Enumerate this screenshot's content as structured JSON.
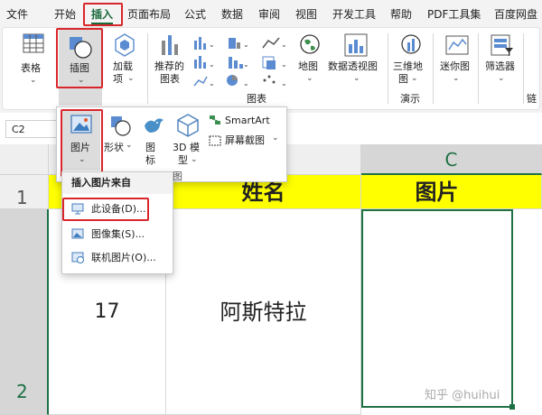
{
  "tabs": [
    "文件",
    "开始",
    "插入",
    "页面布局",
    "公式",
    "数据",
    "审阅",
    "视图",
    "开发工具",
    "帮助",
    "PDF工具集",
    "百度网盘"
  ],
  "active_tab": "插入",
  "ribbon": {
    "table": "表格",
    "illustrations": "插图",
    "addins_line1": "加载",
    "addins_line2": "项",
    "recommended_line1": "推荐的",
    "recommended_line2": "图表",
    "charts_group": "图表",
    "map": "地图",
    "pivot_chart": "数据透视图",
    "map3d_line1": "三维地",
    "map3d_line2": "图",
    "demo_group": "演示",
    "sparkline": "迷你图",
    "filter": "筛选器",
    "link": "链"
  },
  "illustrations_popup": {
    "picture": "图片",
    "shapes": "形状",
    "icons_line1": "图",
    "icons_line2": "标",
    "model3d_line1": "3D 模",
    "model3d_line2": "型",
    "smartart": "SmartArt",
    "screenshot": "屏幕截图",
    "group_label": "图"
  },
  "picture_menu": {
    "header": "插入图片来自",
    "items": [
      "此设备(D)...",
      "图像集(S)...",
      "联机图片(O)..."
    ]
  },
  "name_box": "C2",
  "grid": {
    "col_c": "C",
    "row1": "1",
    "row2": "2",
    "header_name": "姓名",
    "header_picture": "图片",
    "row2_number": "17",
    "row2_name": "阿斯特拉"
  },
  "colors": {
    "accent": "#d9262b",
    "header_fill": "#ffff00",
    "selection": "#1e7145"
  },
  "watermark": "知乎 @huihui"
}
